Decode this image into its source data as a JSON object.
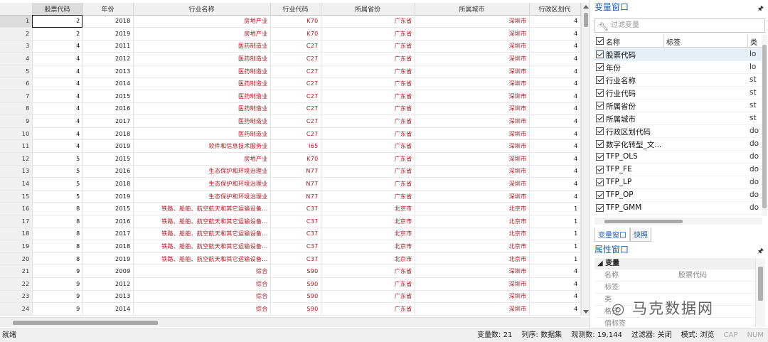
{
  "grid": {
    "columns": [
      "股票代码",
      "年份",
      "行业名称",
      "行业代码",
      "所属省份",
      "所属城市",
      "行政区划代"
    ],
    "rows": [
      [
        "1",
        "2",
        "2018",
        "房地产业",
        "K70",
        "广东省",
        "深圳市",
        "4"
      ],
      [
        "2",
        "2",
        "2019",
        "房地产业",
        "K70",
        "广东省",
        "深圳市",
        "4"
      ],
      [
        "3",
        "4",
        "2011",
        "医药制造业",
        "C27",
        "广东省",
        "深圳市",
        "4"
      ],
      [
        "4",
        "4",
        "2012",
        "医药制造业",
        "C27",
        "广东省",
        "深圳市",
        "4"
      ],
      [
        "5",
        "4",
        "2013",
        "医药制造业",
        "C27",
        "广东省",
        "深圳市",
        "4"
      ],
      [
        "6",
        "4",
        "2014",
        "医药制造业",
        "C27",
        "广东省",
        "深圳市",
        "4"
      ],
      [
        "7",
        "4",
        "2015",
        "医药制造业",
        "C27",
        "广东省",
        "深圳市",
        "4"
      ],
      [
        "8",
        "4",
        "2016",
        "医药制造业",
        "C27",
        "广东省",
        "深圳市",
        "4"
      ],
      [
        "9",
        "4",
        "2017",
        "医药制造业",
        "C27",
        "广东省",
        "深圳市",
        "4"
      ],
      [
        "10",
        "4",
        "2018",
        "医药制造业",
        "C27",
        "广东省",
        "深圳市",
        "4"
      ],
      [
        "11",
        "4",
        "2019",
        "软件和信息技术服务业",
        "I65",
        "广东省",
        "深圳市",
        "4"
      ],
      [
        "12",
        "5",
        "2015",
        "房地产业",
        "K70",
        "广东省",
        "深圳市",
        "4"
      ],
      [
        "13",
        "5",
        "2016",
        "生态保护和环境治理业",
        "N77",
        "广东省",
        "深圳市",
        "4"
      ],
      [
        "14",
        "5",
        "2018",
        "生态保护和环境治理业",
        "N77",
        "广东省",
        "深圳市",
        "4"
      ],
      [
        "15",
        "5",
        "2019",
        "生态保护和环境治理业",
        "N77",
        "广东省",
        "深圳市",
        "4"
      ],
      [
        "16",
        "8",
        "2015",
        "铁路、船舶、航空航天和其它运输设备…",
        "C37",
        "北京市",
        "北京市",
        "1"
      ],
      [
        "17",
        "8",
        "2016",
        "铁路、船舶、航空航天和其它运输设备…",
        "C37",
        "北京市",
        "北京市",
        "1"
      ],
      [
        "18",
        "8",
        "2017",
        "铁路、船舶、航空航天和其它运输设备…",
        "C37",
        "北京市",
        "北京市",
        "1"
      ],
      [
        "19",
        "8",
        "2018",
        "铁路、船舶、航空航天和其它运输设备…",
        "C37",
        "北京市",
        "北京市",
        "1"
      ],
      [
        "20",
        "8",
        "2019",
        "铁路、船舶、航空航天和其它运输设备…",
        "C37",
        "北京市",
        "北京市",
        "1"
      ],
      [
        "21",
        "9",
        "2009",
        "综合",
        "S90",
        "广东省",
        "深圳市",
        "4"
      ],
      [
        "22",
        "9",
        "2012",
        "综合",
        "S90",
        "广东省",
        "深圳市",
        "4"
      ],
      [
        "23",
        "9",
        "2013",
        "综合",
        "S90",
        "广东省",
        "深圳市",
        "4"
      ],
      [
        "24",
        "9",
        "2014",
        "综合",
        "S90",
        "广东省",
        "深圳市",
        "4"
      ]
    ]
  },
  "var_panel": {
    "title": "变量窗口",
    "pin_icon": "pin-icon",
    "filter_placeholder": "过滤变量",
    "head_name": "名称",
    "head_label": "标签",
    "head_type": "类",
    "variables": [
      {
        "name": "股票代码",
        "type": "lo"
      },
      {
        "name": "年份",
        "type": "lo"
      },
      {
        "name": "行业名称",
        "type": "st"
      },
      {
        "name": "行业代码",
        "type": "st"
      },
      {
        "name": "所属省份",
        "type": "st"
      },
      {
        "name": "所属城市",
        "type": "st"
      },
      {
        "name": "行政区划代码",
        "type": "do"
      },
      {
        "name": "数字化转型_文...",
        "type": "do"
      },
      {
        "name": "TFP_OLS",
        "type": "do"
      },
      {
        "name": "TFP_FE",
        "type": "do"
      },
      {
        "name": "TFP_LP",
        "type": "do"
      },
      {
        "name": "TFP_OP",
        "type": "do"
      },
      {
        "name": "TFP_GMM",
        "type": "do"
      }
    ],
    "tabs": [
      "变量窗口",
      "快照"
    ]
  },
  "prop_panel": {
    "title": "属性窗口",
    "group": "变量",
    "rows": [
      {
        "key": "名称",
        "value": "股票代码"
      },
      {
        "key": "标签",
        "value": ""
      },
      {
        "key": "类",
        "value": ""
      },
      {
        "key": "格式",
        "value": ""
      },
      {
        "key": "值标签",
        "value": ""
      }
    ]
  },
  "watermark": "马克数据网",
  "status": {
    "left": "就绪",
    "var_count": "变量数: 21",
    "sort": "列序: 数据集",
    "obs": "观测数: 19,144",
    "filter": "过滤器: 关闭",
    "mode": "模式: 浏览",
    "cap": "CAP",
    "num": "NUM"
  }
}
